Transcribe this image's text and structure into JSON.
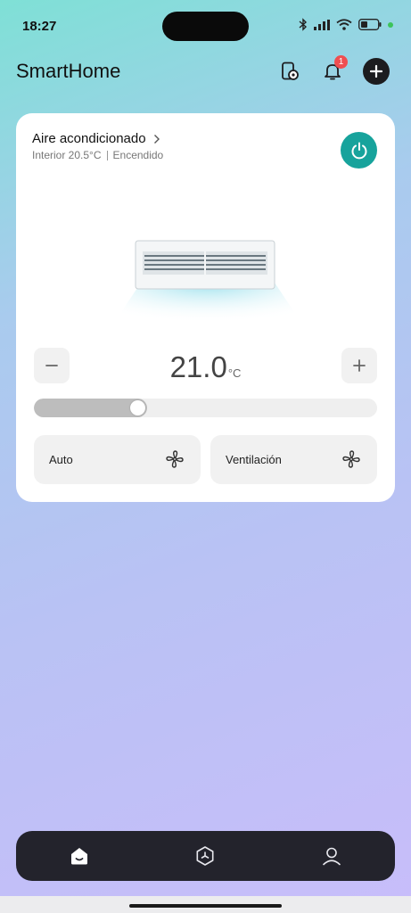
{
  "status_bar": {
    "time": "18:27"
  },
  "header": {
    "title": "SmartHome",
    "notification_count": "1",
    "icons": [
      "device-manage-icon",
      "bell-icon",
      "plus-icon"
    ]
  },
  "device": {
    "name": "Aire acondicionado",
    "indoor_temp": "Interior 20.5°C",
    "state": "Encendido",
    "power_color": "#17a39c"
  },
  "temperature": {
    "value": "21.0",
    "unit": "°C",
    "decrease_icon": "minus-icon",
    "increase_icon": "plus-icon",
    "slider_fraction": 0.33
  },
  "modes": [
    {
      "label": "Auto",
      "icon": "fan-icon"
    },
    {
      "label": "Ventilación",
      "icon": "fan-icon"
    }
  ],
  "bottom_nav": {
    "items": [
      "home-icon",
      "scenes-icon",
      "profile-icon"
    ],
    "active": "home-icon"
  }
}
